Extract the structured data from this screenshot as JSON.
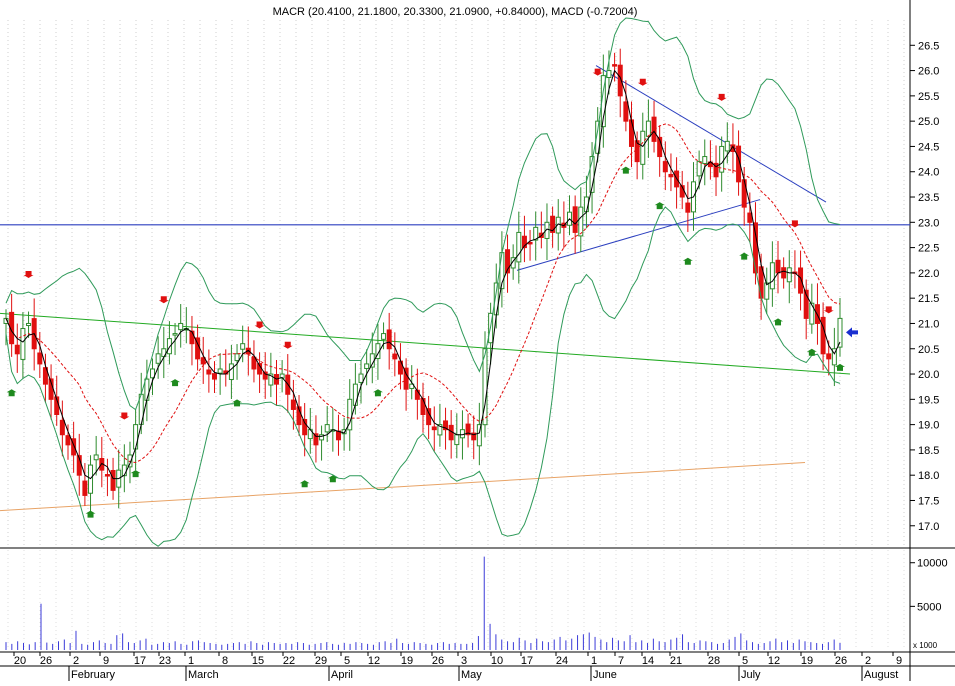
{
  "title": "MACR (20.4100, 21.1800, 20.3300, 21.0900, +0.84000), MACD (-0.72004)",
  "chart_data": [
    {
      "type": "candlestick",
      "name": "price-panel",
      "ylim": [
        16.6,
        27.0
      ],
      "y_ticks": [
        "17.0",
        "17.5",
        "18.0",
        "18.5",
        "19.0",
        "19.5",
        "20.0",
        "20.5",
        "21.0",
        "21.5",
        "22.0",
        "22.5",
        "23.0",
        "23.5",
        "24.0",
        "24.5",
        "25.0",
        "25.5",
        "26.0",
        "26.5"
      ],
      "horizontal_line": 22.95,
      "approx_close": [
        21.1,
        20.6,
        20.4,
        20.9,
        21.0,
        20.5,
        20.2,
        19.8,
        19.5,
        19.2,
        18.8,
        18.6,
        18.4,
        18.0,
        17.6,
        18.2,
        18.4,
        18.1,
        18.0,
        17.7,
        18.1,
        18.2,
        18.4,
        19.0,
        19.6,
        19.9,
        20.1,
        20.4,
        20.5,
        20.7,
        20.8,
        21.0,
        20.9,
        20.6,
        20.3,
        20.2,
        20.0,
        19.9,
        20.1,
        20.0,
        20.2,
        20.4,
        20.6,
        20.4,
        20.1,
        20.0,
        19.9,
        20.0,
        19.8,
        20.0,
        19.6,
        19.3,
        19.0,
        18.8,
        18.9,
        18.6,
        18.8,
        19.0,
        18.9,
        18.7,
        18.9,
        19.5,
        19.8,
        20.0,
        20.2,
        20.4,
        20.6,
        20.8,
        20.5,
        20.3,
        20.0,
        19.7,
        19.8,
        19.5,
        19.2,
        19.0,
        18.9,
        19.0,
        18.9,
        18.7,
        18.8,
        18.9,
        18.8,
        18.7,
        19.0,
        20.5,
        21.2,
        21.8,
        22.4,
        22.0,
        22.3,
        22.8,
        22.5,
        22.6,
        22.9,
        22.7,
        23.0,
        22.8,
        23.1,
        22.9,
        23.2,
        22.8,
        23.3,
        23.5,
        24.3,
        25.0,
        25.9,
        26.0,
        26.1,
        25.5,
        25.0,
        24.5,
        24.2,
        24.8,
        25.0,
        24.6,
        24.3,
        24.0,
        23.9,
        23.7,
        23.5,
        23.2,
        23.8,
        24.2,
        24.3,
        24.1,
        23.9,
        24.5,
        24.6,
        24.4,
        23.8,
        23.3,
        23.0,
        22.0,
        21.5,
        21.8,
        22.2,
        22.0,
        21.9,
        22.1,
        22.0,
        21.6,
        21.1,
        21.4,
        21.0,
        20.4,
        20.3,
        20.5,
        21.1
      ],
      "moving_averages": [
        "black (short MA)",
        "red dashed (mid band)",
        "green (Bollinger bands)"
      ],
      "trendline_colors": [
        "#2b3fbf",
        "#22aa22",
        "#e8a366"
      ]
    },
    {
      "type": "bar",
      "name": "volume-panel",
      "ylim": [
        0,
        11000
      ],
      "y_ticks": [
        "5000",
        "10000"
      ],
      "unit_label": "x 1000",
      "approx_values": [
        900,
        700,
        1000,
        800,
        650,
        900,
        5300,
        850,
        700,
        1000,
        1200,
        800,
        2200,
        700,
        600,
        900,
        1100,
        800,
        700,
        1700,
        1900,
        900,
        800,
        1100,
        1300,
        600,
        700,
        900,
        800,
        1000,
        700,
        600,
        1000,
        1100,
        900,
        800,
        700,
        600,
        700,
        800,
        900,
        700,
        1000,
        800,
        600,
        900,
        800,
        700,
        800,
        700,
        900,
        800,
        600,
        700,
        800,
        900,
        700,
        600,
        800,
        700,
        900,
        800,
        700,
        600,
        900,
        1000,
        800,
        1300,
        800,
        700,
        900,
        800,
        700,
        600,
        800,
        900,
        700,
        800,
        700,
        700,
        800,
        1600,
        10700,
        3000,
        1800,
        1200,
        1000,
        900,
        1400,
        1100,
        800,
        1300,
        1000,
        900,
        1200,
        1500,
        1100,
        1300,
        1700,
        1800,
        2000,
        1500,
        1200,
        900,
        1400,
        1100,
        1000,
        1700,
        900,
        1100,
        800,
        1300,
        1000,
        900,
        1200,
        1400,
        1800,
        900,
        800,
        1100,
        1000,
        900,
        700,
        800,
        1200,
        1500,
        1900,
        1100,
        900,
        700,
        800,
        1000,
        1300,
        900,
        1100,
        800,
        1200,
        1000,
        900,
        800,
        700,
        900,
        1200,
        800
      ]
    }
  ],
  "x_axis": {
    "day_labels": [
      "20",
      "26",
      "2",
      "9",
      "17",
      "23",
      "1",
      "8",
      "15",
      "22",
      "29",
      "5",
      "12",
      "19",
      "26",
      "3",
      "10",
      "17",
      "24",
      "1",
      "7",
      "14",
      "21",
      "28",
      "5",
      "12",
      "19",
      "26",
      "2",
      "9"
    ],
    "month_labels": [
      "February",
      "March",
      "April",
      "May",
      "June",
      "July",
      "August"
    ]
  }
}
